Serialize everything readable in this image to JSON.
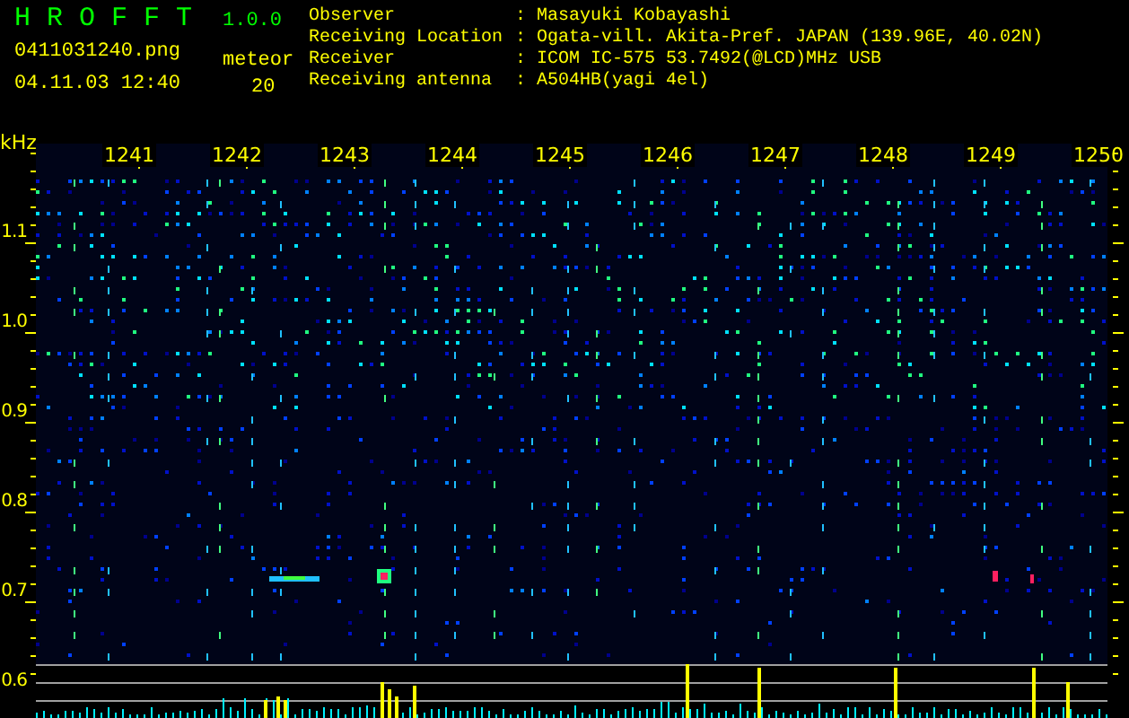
{
  "header": {
    "app_name": "H R O F F T",
    "version": "1.0.0",
    "filename": "0411031240.png",
    "timestamp": "04.11.03 12:40",
    "count_label": "meteor",
    "count_value": "20"
  },
  "info": [
    {
      "label": "Observer",
      "separator": ":",
      "value": "Masayuki Kobayashi"
    },
    {
      "label": "Receiving Location",
      "separator": ":",
      "value": "Ogata-vill. Akita-Pref. JAPAN (139.96E, 40.02N)"
    },
    {
      "label": "Receiver",
      "separator": ":",
      "value": "ICOM IC-575 53.7492(@LCD)MHz USB"
    },
    {
      "label": "Receiving antenna",
      "separator": ":",
      "value": "A504HB(yagi 4el)"
    }
  ],
  "spectrogram": {
    "y_unit": "kHz",
    "y_labels": [
      "1.1",
      "1.0",
      "0.9",
      "0.8",
      "0.7",
      "0.6"
    ],
    "time_labels": [
      "1241",
      "1242",
      "1243",
      "1244",
      "1245",
      "1246",
      "1247",
      "1248",
      "1249",
      "1250"
    ]
  }
}
